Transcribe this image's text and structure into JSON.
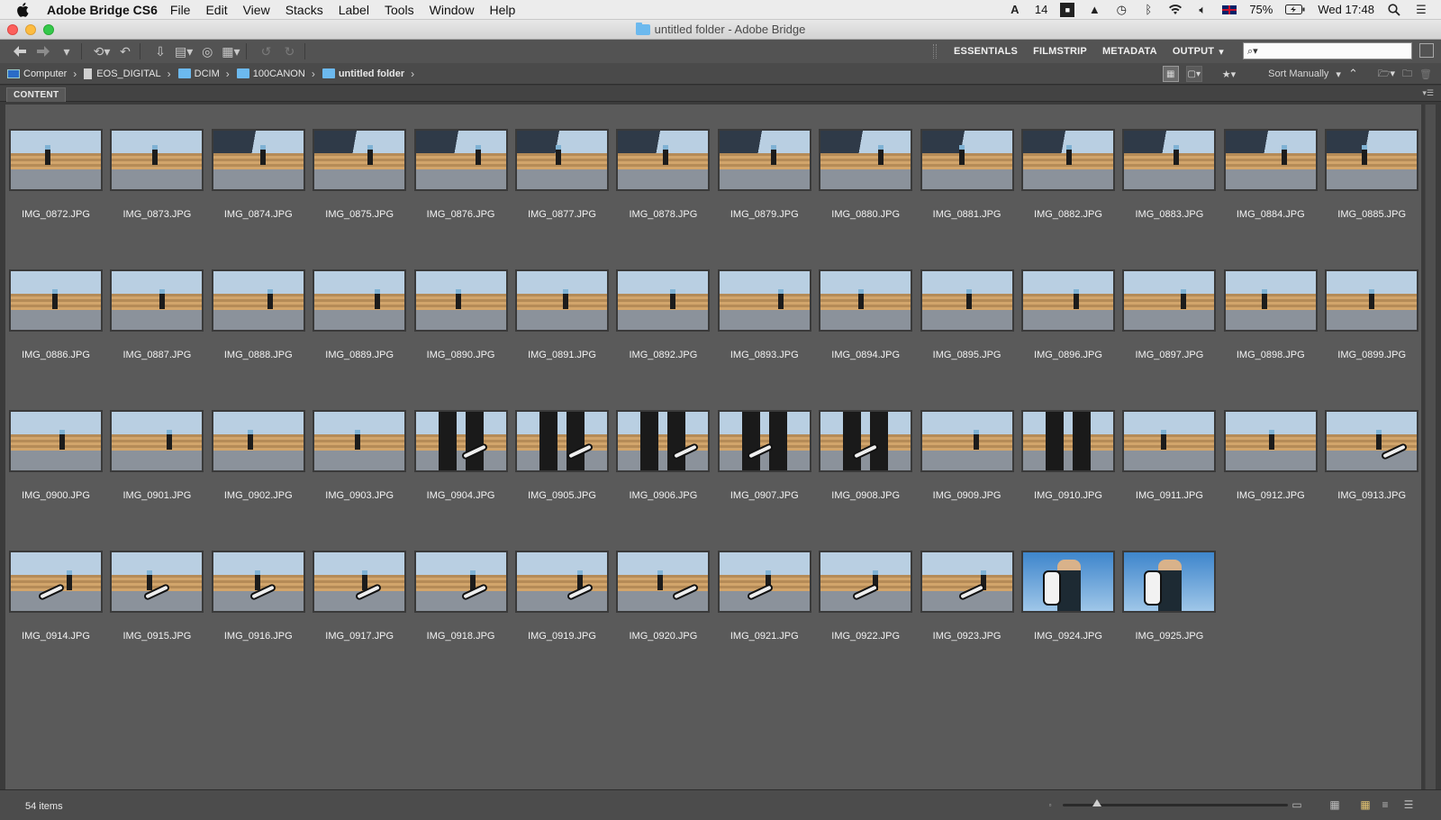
{
  "menubar": {
    "app_name": "Adobe Bridge CS6",
    "items": [
      "File",
      "Edit",
      "View",
      "Stacks",
      "Label",
      "Tools",
      "Window",
      "Help"
    ],
    "adobe_count": "14",
    "battery": "75%",
    "clock": "Wed 17:48"
  },
  "window": {
    "title": "untitled folder - Adobe Bridge"
  },
  "toolbar": {
    "workspaces": [
      "ESSENTIALS",
      "FILMSTRIP",
      "METADATA",
      "OUTPUT"
    ],
    "search_placeholder": ""
  },
  "pathbar": {
    "crumbs": [
      "Computer",
      "EOS_DIGITAL",
      "DCIM",
      "100CANON",
      "untitled folder"
    ],
    "sort_label": "Sort Manually"
  },
  "panel": {
    "tab_label": "CONTENT"
  },
  "files": [
    "IMG_0872.JPG",
    "IMG_0873.JPG",
    "IMG_0874.JPG",
    "IMG_0875.JPG",
    "IMG_0876.JPG",
    "IMG_0877.JPG",
    "IMG_0878.JPG",
    "IMG_0879.JPG",
    "IMG_0880.JPG",
    "IMG_0881.JPG",
    "IMG_0882.JPG",
    "IMG_0883.JPG",
    "IMG_0884.JPG",
    "IMG_0885.JPG",
    "IMG_0886.JPG",
    "IMG_0887.JPG",
    "IMG_0888.JPG",
    "IMG_0889.JPG",
    "IMG_0890.JPG",
    "IMG_0891.JPG",
    "IMG_0892.JPG",
    "IMG_0893.JPG",
    "IMG_0894.JPG",
    "IMG_0895.JPG",
    "IMG_0896.JPG",
    "IMG_0897.JPG",
    "IMG_0898.JPG",
    "IMG_0899.JPG",
    "IMG_0900.JPG",
    "IMG_0901.JPG",
    "IMG_0902.JPG",
    "IMG_0903.JPG",
    "IMG_0904.JPG",
    "IMG_0905.JPG",
    "IMG_0906.JPG",
    "IMG_0907.JPG",
    "IMG_0908.JPG",
    "IMG_0909.JPG",
    "IMG_0910.JPG",
    "IMG_0911.JPG",
    "IMG_0912.JPG",
    "IMG_0913.JPG",
    "IMG_0914.JPG",
    "IMG_0915.JPG",
    "IMG_0916.JPG",
    "IMG_0917.JPG",
    "IMG_0918.JPG",
    "IMG_0919.JPG",
    "IMG_0920.JPG",
    "IMG_0921.JPG",
    "IMG_0922.JPG",
    "IMG_0923.JPG",
    "IMG_0924.JPG",
    "IMG_0925.JPG"
  ],
  "status": {
    "item_count": "54 items",
    "thumbnail_size_fraction": 0.15
  },
  "colors": {
    "content_bg": "#5a5a5a",
    "toolbar_bg": "#535353",
    "folder_accent": "#6cb9ee"
  }
}
